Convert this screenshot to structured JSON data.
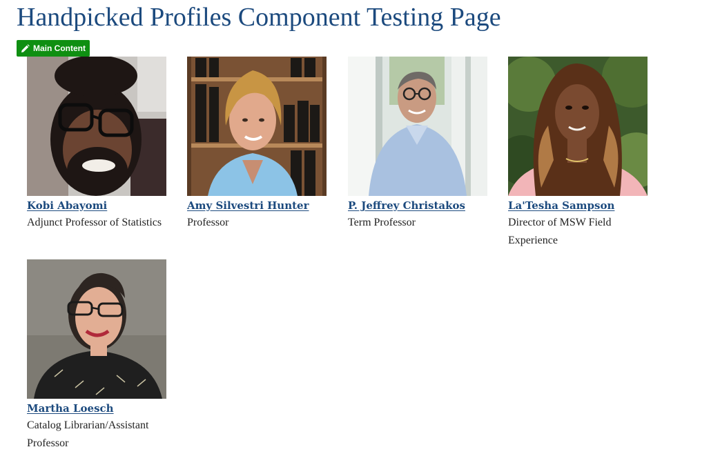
{
  "page": {
    "title": "Handpicked Profiles Component Testing Page"
  },
  "edit_tab": {
    "label": "Main Content",
    "icon": "pencil-icon",
    "color": "#0f8f12"
  },
  "colors": {
    "heading": "#1c4a7e",
    "link": "#1c4a7e",
    "text": "#222222"
  },
  "profiles": [
    {
      "name": "Kobi Abayomi",
      "title": "Adjunct Professor of Statistics"
    },
    {
      "name": "Amy Silvestri Hunter",
      "title": "Professor"
    },
    {
      "name": "P. Jeffrey Christakos",
      "title": "Term Professor"
    },
    {
      "name": "La'Tesha Sampson",
      "title": "Director of MSW Field Experience"
    },
    {
      "name": "Martha Loesch",
      "title": "Catalog Librarian/Assistant Professor"
    }
  ]
}
